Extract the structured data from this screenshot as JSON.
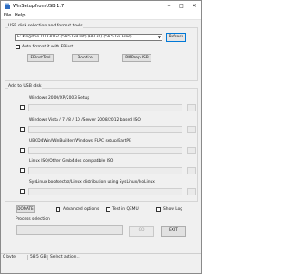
{
  "window": {
    "title": "WinSetupFromUSB 1.7"
  },
  "menu": {
    "file": "File",
    "help": "Help"
  },
  "disk_section": {
    "label": "USB disk selection and format tools",
    "selected_disk": "E: Kingston DTR30G2 (58.5 GB Tot) (FAT32) (58.5 GB Free)",
    "refresh_label": "Refresh",
    "auto_format_label": "Auto format it with FBinst",
    "fbinst_label": "FBinstTool",
    "bootice_label": "Bootice",
    "rmprep_label": "RMPrepUSB"
  },
  "add_section": {
    "label": "Add to USB disk",
    "sources": [
      {
        "label": "Windows 2000/XP/2003 Setup"
      },
      {
        "label": "Windows Vista / 7 / 8 / 10 /Server 2008/2012 based ISO"
      },
      {
        "label": "UBCD4Win/WinBuilder/Windows FLPC setup/BartPE"
      },
      {
        "label": "Linux ISO/Other Grub4dos compatible ISO"
      },
      {
        "label": "SysLinux bootsector/Linux distribution using SysLinux/IsoLinux"
      }
    ]
  },
  "options": {
    "donate_label": "DONATE",
    "advanced_label": "Advanced options",
    "qemu_label": "Test in QEMU",
    "log_label": "Show Log"
  },
  "process": {
    "label": "Process selection",
    "go_label": "GO",
    "exit_label": "EXIT"
  },
  "status": {
    "size_bytes": "0 byte",
    "size_free": "58,5 GB",
    "message": "Select action..."
  },
  "colors": {
    "window_bg": "#f0f0f0",
    "focus_border": "#0078d7"
  }
}
